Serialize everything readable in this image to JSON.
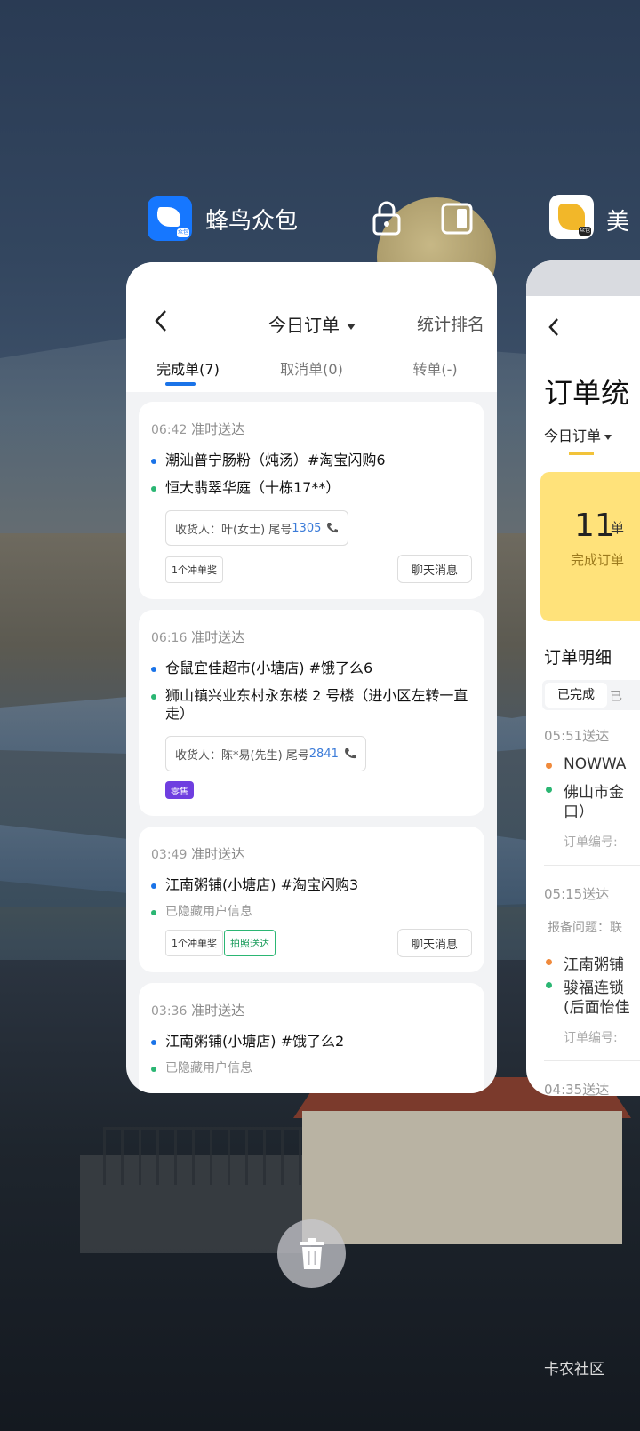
{
  "left_app": {
    "name": "蜂鸟众包",
    "icon": "hummingbird-app-icon",
    "icon_badge": "众包"
  },
  "card": {
    "title": "今日订单",
    "rank_label": "统计排名",
    "tabs": [
      {
        "label": "完成单(7)"
      },
      {
        "label": "取消单(0)"
      },
      {
        "label": "转单(-)"
      }
    ],
    "orders": [
      {
        "time": "06:42",
        "status": "准时送达",
        "pickup": "潮汕普宁肠粉（炖汤）#淘宝闪购6",
        "dropoff": "恒大翡翠华庭（十栋17**）",
        "receiver_prefix": "收货人：叶(女士) 尾号",
        "receiver_tail": "1305",
        "chip1": "1个冲单奖",
        "chat": "聊天消息"
      },
      {
        "time": "06:16",
        "status": "准时送达",
        "pickup": "仓鼠宜佳超市(小塘店) #饿了么6",
        "dropoff": "狮山镇兴业东村永东楼 2 号楼（进小区左转一直走）",
        "receiver_prefix": "收货人：陈*易(先生) 尾号",
        "receiver_tail": "2841",
        "chip1": "零售"
      },
      {
        "time": "03:49",
        "status": "准时送达",
        "pickup": "江南粥铺(小塘店) #淘宝闪购3",
        "dropoff": "已隐藏用户信息",
        "chip1": "1个冲单奖",
        "chip2": "拍照送达",
        "chat": "聊天消息"
      },
      {
        "time": "03:36",
        "status": "准时送达",
        "pickup": "江南粥铺(小塘店) #饿了么2",
        "dropoff": "已隐藏用户信息"
      }
    ]
  },
  "right_app": {
    "name": "美",
    "icon": "kangaroo-app-icon",
    "icon_badge": "众包",
    "title": "订单统",
    "today": "今日订单",
    "big_number": "11",
    "big_unit": "单",
    "sub": "完成订单",
    "detail": "订单明细",
    "tab_active": "已完成",
    "tab2": "已",
    "items": [
      {
        "time": "05:51送达",
        "line1": "NOWWA",
        "line2": "佛山市金",
        "line2b": "口）",
        "meta": "订单编号:"
      },
      {
        "time": "05:15送达",
        "report": "报备问题：联",
        "line1": "江南粥铺",
        "line2": "骏福连锁",
        "line2b": "(后面怡佳",
        "meta": "订单编号:"
      },
      {
        "time": "04:35送达"
      }
    ]
  },
  "watermark": "卡农社区",
  "colors": {
    "accent_blue": "#1a73e8",
    "green": "#2bb673",
    "purple_chip": "#6f3ee0",
    "yellow_card": "#ffe27a"
  }
}
